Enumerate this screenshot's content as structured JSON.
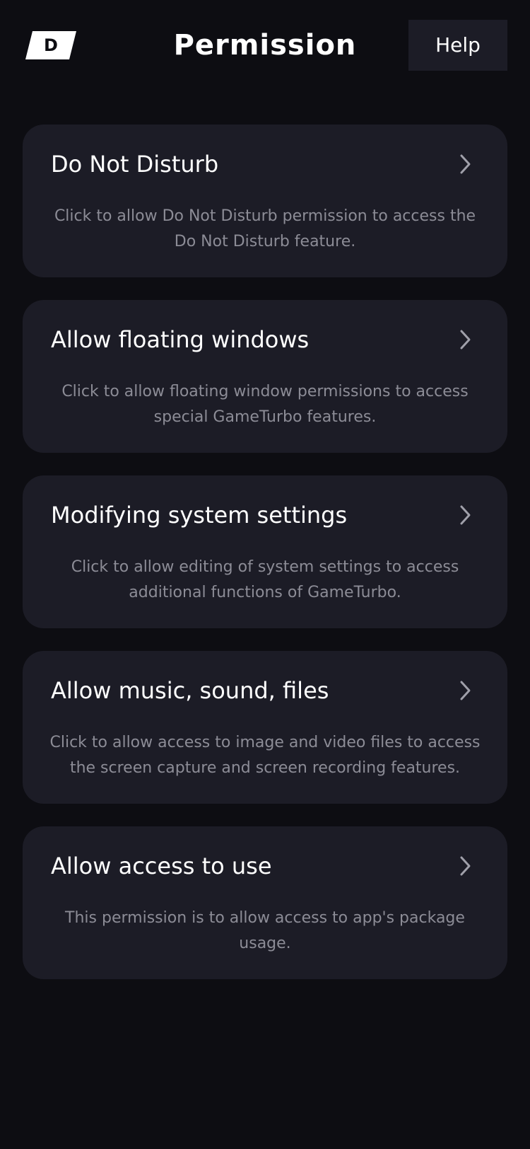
{
  "header": {
    "logo_letter": "D",
    "title": "Permission",
    "help_label": "Help"
  },
  "permissions": [
    {
      "title": "Do Not Disturb",
      "description": "Click to allow Do Not Disturb permission to access the Do Not Disturb feature.",
      "icon": "chevron-right-icon"
    },
    {
      "title": "Allow floating windows",
      "description": "Click to allow floating window permissions to access special GameTurbo features.",
      "icon": "chevron-right-icon"
    },
    {
      "title": "Modifying system settings",
      "description": "Click to allow editing of system settings to access additional functions of GameTurbo.",
      "icon": "chevron-right-icon"
    },
    {
      "title": "Allow music, sound, files",
      "description": "Click to allow access to image and video files to access the screen capture and screen recording features.",
      "icon": "chevron-right-icon"
    },
    {
      "title": "Allow access to use",
      "description": "This permission is to allow access to app's package usage.",
      "icon": "chevron-right-icon"
    }
  ],
  "colors": {
    "background": "#0d0d12",
    "card": "#1c1c26",
    "title_text": "#ffffff",
    "description_text": "#8c8c96",
    "chevron": "#a0a0aa"
  }
}
